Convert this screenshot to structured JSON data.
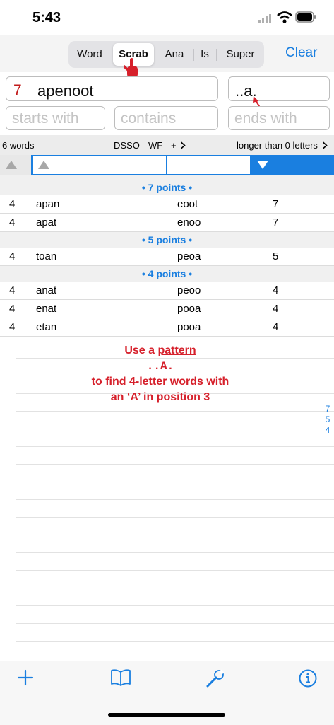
{
  "status_bar": {
    "time": "5:43"
  },
  "mode_tabs": [
    {
      "label": "Word"
    },
    {
      "label": "Scrab"
    },
    {
      "label": "Ana"
    },
    {
      "label": "Is"
    },
    {
      "label": "Super"
    }
  ],
  "selected_mode": "Scrab",
  "clear_label": "Clear",
  "letter_count": "7",
  "letters": "apenoot",
  "pattern": "..a.",
  "filters": {
    "starts_with": "starts with",
    "contains": "contains",
    "ends_with": "ends with"
  },
  "info_bar": {
    "word_count": "6 words",
    "dictionary": "DSSO",
    "wf": "WF",
    "plus": "+",
    "length_filter": "longer than 0 letters"
  },
  "groups": [
    {
      "label": "• 7 points •",
      "rows": [
        {
          "len": "4",
          "word": "apan",
          "remaining": "eoot",
          "score": "7"
        },
        {
          "len": "4",
          "word": "apat",
          "remaining": "enoo",
          "score": "7"
        }
      ]
    },
    {
      "label": "• 5 points •",
      "rows": [
        {
          "len": "4",
          "word": "toan",
          "remaining": "peoa",
          "score": "5"
        }
      ]
    },
    {
      "label": "• 4 points •",
      "rows": [
        {
          "len": "4",
          "word": "anat",
          "remaining": "peoo",
          "score": "4"
        },
        {
          "len": "4",
          "word": "enat",
          "remaining": "pooa",
          "score": "4"
        },
        {
          "len": "4",
          "word": "etan",
          "remaining": "pooa",
          "score": "4"
        }
      ]
    }
  ],
  "annotation": {
    "line1_prefix": "Use a ",
    "line1_link": "pattern",
    "pattern": "..A.",
    "line3": "to find 4-letter words with",
    "line4": "an ‘A’ in position 3"
  },
  "section_index": [
    "7",
    "5",
    "4"
  ],
  "tab_bar": [
    "plus-icon",
    "book-icon",
    "wrench-icon",
    "info-icon"
  ],
  "colors": {
    "accent": "#1a7fe0",
    "annotation": "#d6202b",
    "letter_count": "#c21a1a"
  }
}
